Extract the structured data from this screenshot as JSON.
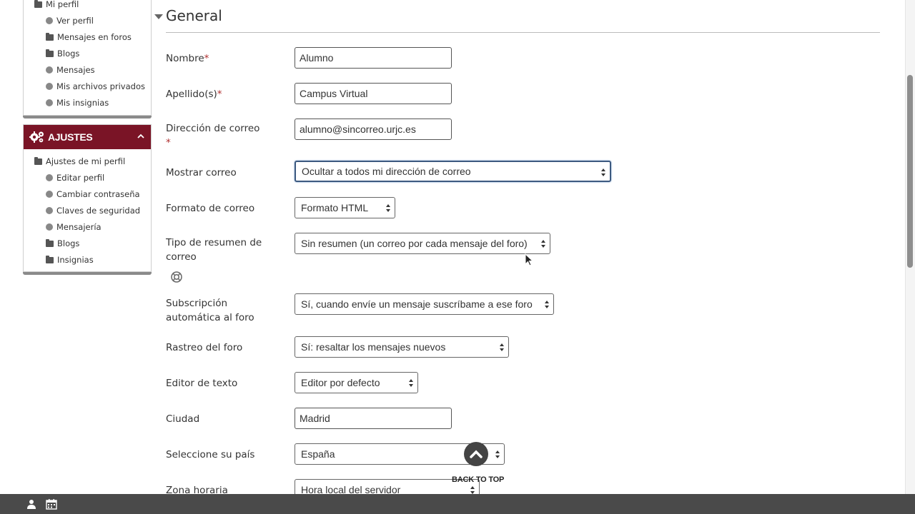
{
  "sidebar": {
    "block1": {
      "items": [
        {
          "label": "Mi perfil",
          "icon": "folder-icon"
        },
        {
          "label": "Ver perfil",
          "icon": "dot-icon"
        },
        {
          "label": "Mensajes en foros",
          "icon": "folder-icon"
        },
        {
          "label": "Blogs",
          "icon": "folder-icon"
        },
        {
          "label": "Mensajes",
          "icon": "dot-icon"
        },
        {
          "label": "Mis archivos privados",
          "icon": "dot-icon"
        },
        {
          "label": "Mis insignias",
          "icon": "dot-icon"
        }
      ]
    },
    "block2": {
      "title": "AJUSTES",
      "items": [
        {
          "label": "Ajustes de mi perfil",
          "icon": "folder-icon"
        },
        {
          "label": "Editar perfil",
          "icon": "dot-icon"
        },
        {
          "label": "Cambiar contraseña",
          "icon": "dot-icon"
        },
        {
          "label": "Claves de seguridad",
          "icon": "dot-icon"
        },
        {
          "label": "Mensajería",
          "icon": "dot-icon"
        },
        {
          "label": "Blogs",
          "icon": "folder-icon"
        },
        {
          "label": "Insignias",
          "icon": "folder-icon"
        }
      ]
    },
    "accent_color": "#7a1426"
  },
  "main": {
    "section_title": "General",
    "fields": {
      "nombre": {
        "label": "Nombre",
        "required_mark": "*",
        "value": "Alumno"
      },
      "apellidos": {
        "label": "Apellido(s)",
        "required_mark": "*",
        "value": "Campus Virtual"
      },
      "correo": {
        "label": "Dirección de correo",
        "required_mark": "*",
        "value": "alumno@sincorreo.urjc.es"
      },
      "mostrar_correo": {
        "label": "Mostrar correo",
        "value": "Ocultar a todos mi dirección de correo"
      },
      "formato_correo": {
        "label": "Formato de correo",
        "value": "Formato HTML"
      },
      "tipo_resumen": {
        "label": "Tipo de resumen de correo",
        "value": "Sin resumen (un correo por cada mensaje del foro)"
      },
      "subscripcion": {
        "label": "Subscripción automática al foro",
        "value": "Sí, cuando envíe un mensaje suscríbame a ese foro"
      },
      "rastreo": {
        "label": "Rastreo del foro",
        "value": "Sí: resaltar los mensajes nuevos"
      },
      "editor": {
        "label": "Editor de texto",
        "value": "Editor por defecto"
      },
      "ciudad": {
        "label": "Ciudad",
        "value": "Madrid"
      },
      "pais": {
        "label": "Seleccione su país",
        "value": "España"
      },
      "zona": {
        "label": "Zona horaria",
        "value": "Hora local del servidor"
      }
    }
  },
  "back_to_top": {
    "label": "BACK TO TOP"
  }
}
